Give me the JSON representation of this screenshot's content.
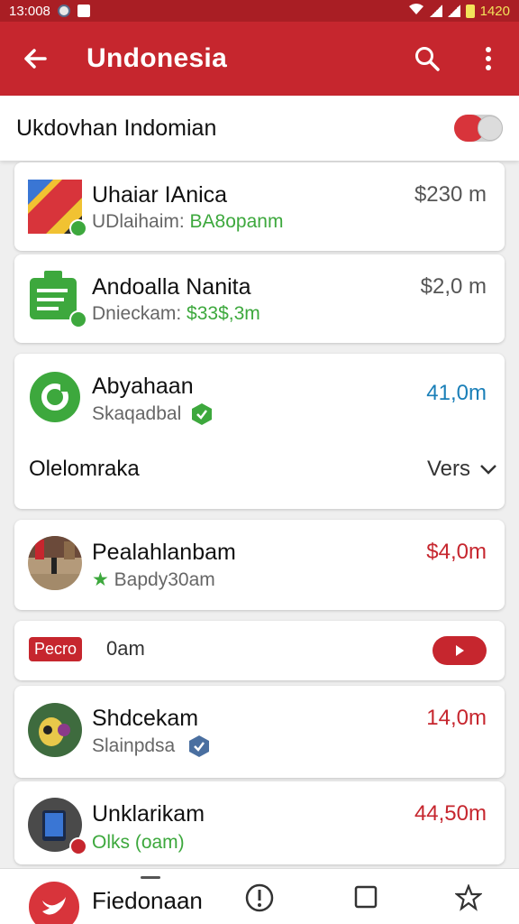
{
  "status_bar": {
    "time": "13:008",
    "time_right": "1420"
  },
  "app_bar": {
    "title": "Undonesia"
  },
  "filter": {
    "label": "Ukdovhan Indomian",
    "toggle_on": true
  },
  "items": [
    {
      "name": "Uhaiar IAnica",
      "sub_prefix": "UDlaihaim:",
      "sub_highlight": "BA8opanm",
      "amount": "$230 m",
      "amount_color": "#555555",
      "icon": "windows-logo-icon"
    },
    {
      "name": "Andoalla Nanita",
      "sub_prefix": "Dnieckam:",
      "sub_highlight": "$33$,3m",
      "amount": "$2,0 m",
      "amount_color": "#555555",
      "icon": "document-icon"
    },
    {
      "name": "Abyahaan",
      "sub_prefix": "Skaqadbal",
      "sub_highlight": "",
      "amount": "41,0m",
      "amount_color": "#1a7fb8",
      "icon": "ring-icon"
    },
    {
      "name": "Pealahlanbam",
      "sub_prefix": "Bapdy30am",
      "sub_highlight": "",
      "amount": "$4,0m",
      "amount_color": "#c6262e",
      "icon": "photo-avatar-icon"
    },
    {
      "name": "Shdcekam",
      "sub_prefix": "Slainpdsa",
      "sub_highlight": "",
      "amount": "14,0m",
      "amount_color": "#c6262e",
      "icon": "eye-avatar-icon"
    },
    {
      "name": "Unklarikam",
      "sub_prefix": "Olks (oam)",
      "sub_highlight": "",
      "amount": "44,50m",
      "amount_color": "#c6262e",
      "icon": "phone-avatar-icon"
    }
  ],
  "section": {
    "label": "Olelomraka",
    "action": "Vers"
  },
  "promo": {
    "badge": "Pecro",
    "text": "0am"
  },
  "bottom_nav": {
    "label": "Fiedonaan"
  },
  "colors": {
    "primary": "#c6262e",
    "dark_primary": "#a91e24",
    "accent_green": "#3da83d",
    "accent_blue": "#1a7fb8"
  }
}
